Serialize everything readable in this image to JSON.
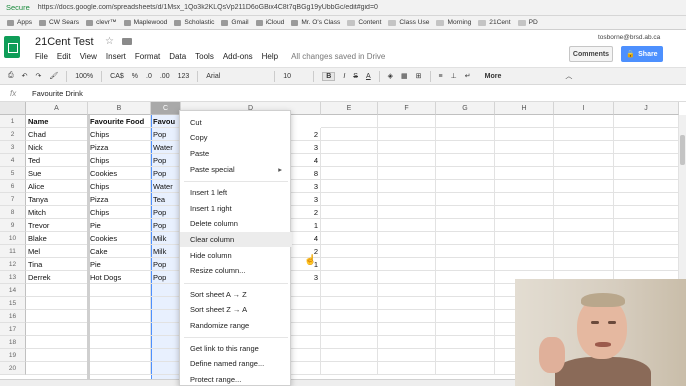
{
  "browser": {
    "secure_label": "Secure",
    "url": "https://docs.google.com/spreadsheets/d/1Msx_1Qo3k2KLQsVp211D6oGBix4C8t7qBGg19yUbbGc/edit#gid=0",
    "bookmarks": [
      "Apps",
      "CW Sears",
      "clevr™",
      "Maplewood",
      "Scholastic",
      "Gmail",
      "iCloud",
      "Mr. O's Class",
      "Content",
      "Class Use",
      "Morning",
      "21Cent",
      "PD"
    ]
  },
  "doc": {
    "title": "21Cent Test",
    "menus": [
      "File",
      "Edit",
      "View",
      "Insert",
      "Format",
      "Data",
      "Tools",
      "Add-ons",
      "Help"
    ],
    "saved_status": "All changes saved in Drive",
    "user_email": "tosborne@brsd.ab.ca",
    "comments_label": "Comments",
    "share_label": "Share"
  },
  "toolbar": {
    "zoom": "100%",
    "currency": "CA$",
    "percent": "%",
    "dec_less": ".0",
    "dec_more": ".00",
    "format": "123",
    "font": "Arial",
    "font_size": "10",
    "bold": "B",
    "more": "More"
  },
  "formula_bar": {
    "fx": "fx",
    "value": "Favourite Drink"
  },
  "grid": {
    "columns": [
      "A",
      "B",
      "C",
      "D",
      "E",
      "F",
      "G",
      "H",
      "I",
      "J"
    ],
    "row_numbers": [
      "1",
      "2",
      "3",
      "4",
      "5",
      "6",
      "7",
      "8",
      "9",
      "10",
      "11",
      "12",
      "13",
      "14",
      "15",
      "16",
      "17",
      "18",
      "19",
      "20"
    ],
    "header": {
      "name": "Name",
      "food": "Favourite Food",
      "drink": "Favou"
    },
    "rows": [
      {
        "name": "Chad",
        "food": "Chips",
        "drink": "Pop",
        "d": "2"
      },
      {
        "name": "Nick",
        "food": "Pizza",
        "drink": "Water",
        "d": "3"
      },
      {
        "name": "Ted",
        "food": "Chips",
        "drink": "Pop",
        "d": "4"
      },
      {
        "name": "Sue",
        "food": "Cookies",
        "drink": "Pop",
        "d": "8"
      },
      {
        "name": "Alice",
        "food": "Chips",
        "drink": "Water",
        "d": "3"
      },
      {
        "name": "Tanya",
        "food": "Pizza",
        "drink": "Tea",
        "d": "3"
      },
      {
        "name": "Mitch",
        "food": "Chips",
        "drink": "Pop",
        "d": "2"
      },
      {
        "name": "Trevor",
        "food": "Pie",
        "drink": "Pop",
        "d": "1"
      },
      {
        "name": "Blake",
        "food": "Cookies",
        "drink": "Milk",
        "d": "4"
      },
      {
        "name": "Mel",
        "food": "Cake",
        "drink": "Milk",
        "d": "2"
      },
      {
        "name": "Tina",
        "food": "Pie",
        "drink": "Pop",
        "d": "1"
      },
      {
        "name": "Derrek",
        "food": "Hot Dogs",
        "drink": "Pop",
        "d": "3"
      }
    ]
  },
  "context_menu": {
    "cut": "Cut",
    "copy": "Copy",
    "paste": "Paste",
    "paste_special": "Paste special",
    "paste_special_arrow": "▸",
    "insert_left": "Insert 1 left",
    "insert_right": "Insert 1 right",
    "delete_column": "Delete column",
    "clear_column": "Clear column",
    "hide_column": "Hide column",
    "resize_column": "Resize column...",
    "sort_az": "Sort sheet A → Z",
    "sort_za": "Sort sheet Z → A",
    "randomize": "Randomize range",
    "get_link": "Get link to this range",
    "define_named": "Define named range...",
    "protect": "Protect range..."
  },
  "colors": {
    "sheets_green": "#0f9d58",
    "share_blue": "#4d90fe",
    "selection_fill": "#e8f0fe"
  }
}
